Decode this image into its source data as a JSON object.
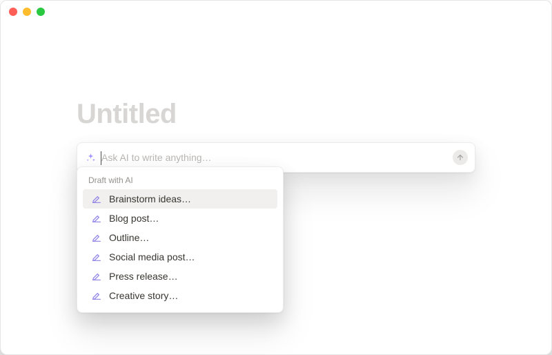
{
  "page": {
    "title_placeholder": "Untitled"
  },
  "ai_input": {
    "placeholder": "Ask AI to write anything…",
    "value": ""
  },
  "dropdown": {
    "header": "Draft with AI",
    "items": [
      {
        "label": "Brainstorm ideas…",
        "hover": true
      },
      {
        "label": "Blog post…",
        "hover": false
      },
      {
        "label": "Outline…",
        "hover": false
      },
      {
        "label": "Social media post…",
        "hover": false
      },
      {
        "label": "Press release…",
        "hover": false
      },
      {
        "label": "Creative story…",
        "hover": false
      }
    ]
  }
}
